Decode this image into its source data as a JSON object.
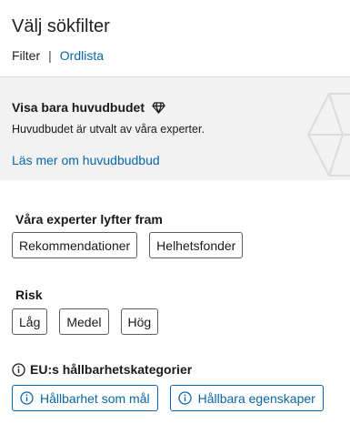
{
  "header": {
    "title": "Välj sökfilter",
    "filter_label": "Filter",
    "separator": "|",
    "glossary_link": "Ordlista"
  },
  "promo": {
    "title": "Visa bara huvudbudet",
    "description": "Huvudbudet är utvalt av våra experter.",
    "link": "Läs mer om huvudbudbud"
  },
  "experts": {
    "title": "Våra experter lyfter fram",
    "chips": [
      "Rekommendationer",
      "Helhetsfonder"
    ]
  },
  "risk": {
    "title": "Risk",
    "chips": [
      "Låg",
      "Medel",
      "Hög"
    ]
  },
  "eu": {
    "title": "EU:s hållbarhetskategorier",
    "chips": [
      "Hållbarhet som mål",
      "Hållbara egenskaper"
    ]
  },
  "colors": {
    "link": "#0a66a8",
    "promo_bg": "#f2f2f2"
  },
  "icons": {
    "promo": "diamond-icon",
    "info": "info-icon"
  }
}
